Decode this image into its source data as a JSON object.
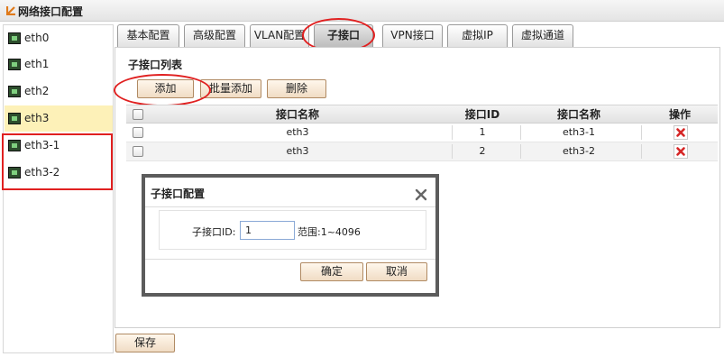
{
  "header": {
    "title": "网络接口配置"
  },
  "sidebar": {
    "items": [
      {
        "label": "eth0"
      },
      {
        "label": "eth1"
      },
      {
        "label": "eth2"
      },
      {
        "label": "eth3",
        "selected": true
      },
      {
        "label": "eth3-1"
      },
      {
        "label": "eth3-2"
      }
    ]
  },
  "tabs": [
    {
      "label": "基本配置"
    },
    {
      "label": "高级配置"
    },
    {
      "label": "VLAN配置"
    },
    {
      "label": "子接口",
      "active": true
    },
    {
      "label": "VPN接口"
    },
    {
      "label": "虚拟IP"
    },
    {
      "label": "虚拟通道"
    }
  ],
  "subinterface_list": {
    "title": "子接口列表",
    "add_label": "添加",
    "batch_add_label": "批量添加",
    "delete_label": "删除",
    "columns": [
      "接口名称",
      "接口ID",
      "接口名称",
      "操作"
    ],
    "rows": [
      {
        "name": "eth3",
        "id": "1",
        "sub_name": "eth3-1"
      },
      {
        "name": "eth3",
        "id": "2",
        "sub_name": "eth3-2"
      }
    ]
  },
  "dialog": {
    "title": "子接口配置",
    "field_label": "子接口ID:",
    "field_value": "1",
    "range_text": "范围:1~4096",
    "confirm_label": "确定",
    "cancel_label": "取消"
  },
  "footer": {
    "save_label": "保存"
  },
  "colors": {
    "annotation": "#e02020",
    "selected_row": "#fdf1b8",
    "button_border": "#b08a63"
  }
}
